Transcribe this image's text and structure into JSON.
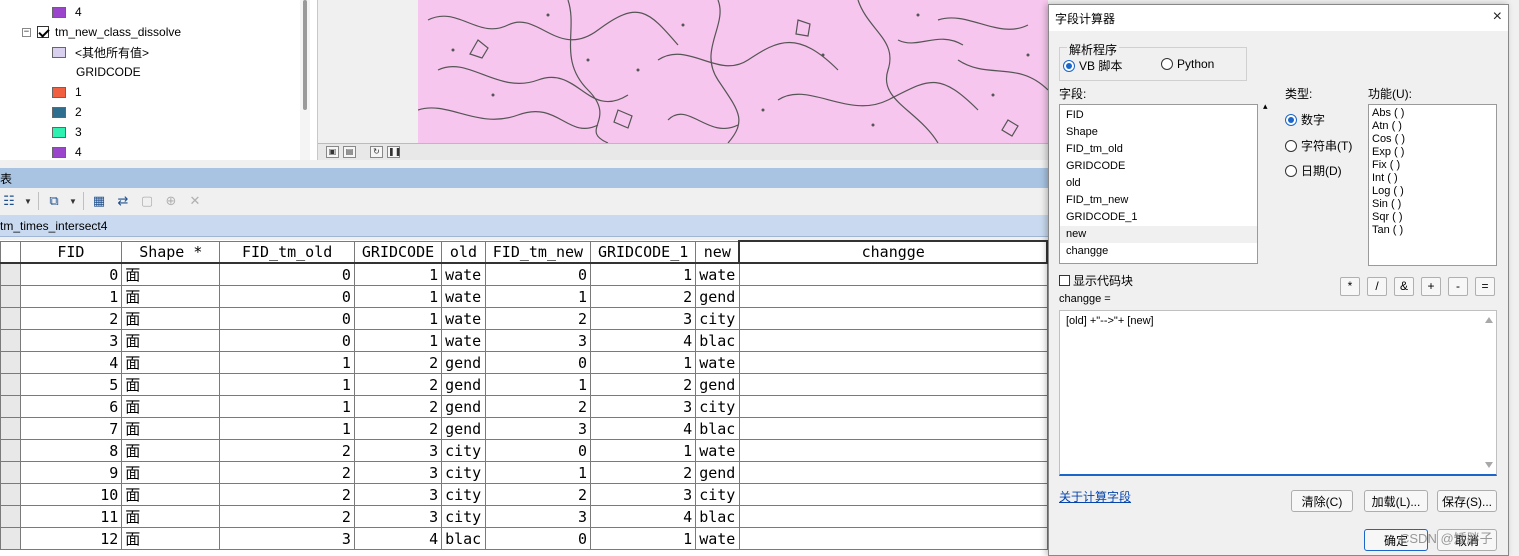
{
  "toc": {
    "items": [
      {
        "type": "class",
        "swatch": "#9b45cc",
        "label": "4"
      },
      {
        "type": "layer",
        "label": "tm_new_class_dissolve"
      },
      {
        "type": "class",
        "swatch": "#d8d0ee",
        "label": "<其他所有值>"
      },
      {
        "type": "heading",
        "label": "GRIDCODE"
      },
      {
        "type": "class",
        "swatch": "#f06040",
        "label": "1"
      },
      {
        "type": "class",
        "swatch": "#2e6e8e",
        "label": "2"
      },
      {
        "type": "class",
        "swatch": "#2ef0b0",
        "label": "3"
      },
      {
        "type": "class",
        "swatch": "#9b45cc",
        "label": "4"
      }
    ]
  },
  "table_window": {
    "title": "表",
    "tab_label": "tm_times_intersect4",
    "columns": [
      "FID",
      "Shape *",
      "FID_tm_old",
      "GRIDCODE",
      "old",
      "FID_tm_new",
      "GRIDCODE_1",
      "new",
      "changge"
    ],
    "rows": [
      [
        "0",
        "面",
        "0",
        "1",
        "wate",
        "0",
        "1",
        "wate",
        ""
      ],
      [
        "1",
        "面",
        "0",
        "1",
        "wate",
        "1",
        "2",
        "gend",
        ""
      ],
      [
        "2",
        "面",
        "0",
        "1",
        "wate",
        "2",
        "3",
        "city",
        ""
      ],
      [
        "3",
        "面",
        "0",
        "1",
        "wate",
        "3",
        "4",
        "blac",
        ""
      ],
      [
        "4",
        "面",
        "1",
        "2",
        "gend",
        "0",
        "1",
        "wate",
        ""
      ],
      [
        "5",
        "面",
        "1",
        "2",
        "gend",
        "1",
        "2",
        "gend",
        ""
      ],
      [
        "6",
        "面",
        "1",
        "2",
        "gend",
        "2",
        "3",
        "city",
        ""
      ],
      [
        "7",
        "面",
        "1",
        "2",
        "gend",
        "3",
        "4",
        "blac",
        ""
      ],
      [
        "8",
        "面",
        "2",
        "3",
        "city",
        "0",
        "1",
        "wate",
        ""
      ],
      [
        "9",
        "面",
        "2",
        "3",
        "city",
        "1",
        "2",
        "gend",
        ""
      ],
      [
        "10",
        "面",
        "2",
        "3",
        "city",
        "2",
        "3",
        "city",
        ""
      ],
      [
        "11",
        "面",
        "2",
        "3",
        "city",
        "3",
        "4",
        "blac",
        ""
      ],
      [
        "12",
        "面",
        "3",
        "4",
        "blac",
        "0",
        "1",
        "wate",
        ""
      ]
    ]
  },
  "dialog": {
    "title": "字段计算器",
    "close_icon": "×",
    "parser_label": "解析程序",
    "parser_options": [
      "VB 脚本",
      "Python"
    ],
    "parser_selected": "VB 脚本",
    "fields_label": "字段:",
    "fields": [
      "FID",
      "Shape",
      "FID_tm_old",
      "GRIDCODE",
      "old",
      "FID_tm_new",
      "GRIDCODE_1",
      "new",
      "changge"
    ],
    "type_label": "类型:",
    "types": [
      "数字",
      "字符串(T)",
      "日期(D)"
    ],
    "type_selected": "数字",
    "functions_label": "功能(U):",
    "functions": [
      "Abs ( )",
      "Atn ( )",
      "Cos ( )",
      "Exp ( )",
      "Fix ( )",
      "Int ( )",
      "Log ( )",
      "Sin ( )",
      "Sqr ( )",
      "Tan ( )"
    ],
    "show_codeblock_label": "显示代码块",
    "operators": [
      "*",
      "/",
      "&",
      "+",
      "-",
      "="
    ],
    "expression_label": "changge =",
    "expression": "[old] +\"-->\"+ [new]",
    "help_link": "关于计算字段",
    "buttons": {
      "clear": "清除(C)",
      "load": "加载(L)...",
      "save": "保存(S)...",
      "ok": "确定",
      "cancel": "取消"
    }
  },
  "watermark": "CSDN @矮胖子"
}
